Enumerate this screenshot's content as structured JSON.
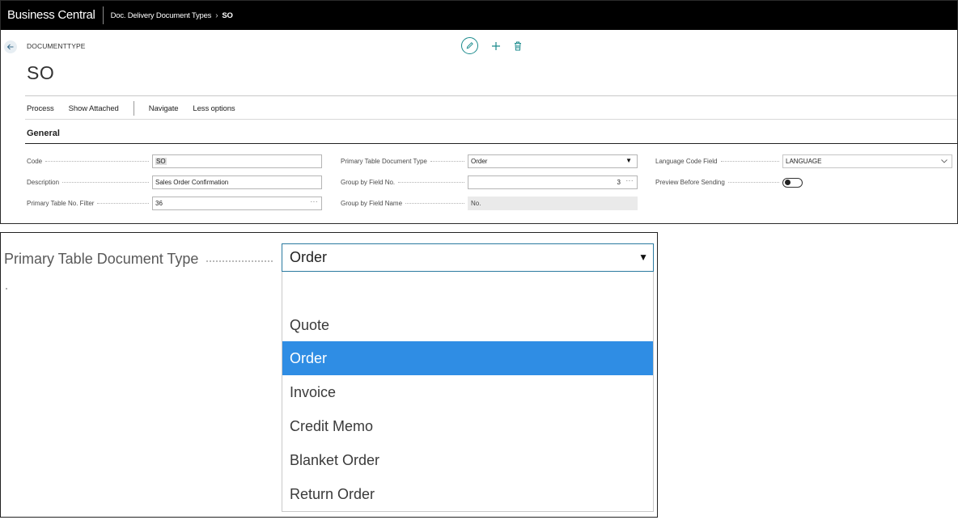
{
  "topbar": {
    "app_name": "Business Central",
    "breadcrumb_parent": "Doc. Delivery Document Types",
    "breadcrumb_separator": "›",
    "breadcrumb_current": "SO"
  },
  "page": {
    "caption": "DOCUMENTTYPE",
    "title": "SO"
  },
  "toolbar": {
    "edit_icon": "pencil-icon",
    "new_icon": "plus-icon",
    "delete_icon": "trash-icon"
  },
  "actions": {
    "process": "Process",
    "show_attached": "Show Attached",
    "navigate": "Navigate",
    "less_options": "Less options"
  },
  "section": {
    "title": "General"
  },
  "fields": {
    "code": {
      "label": "Code",
      "value": "SO"
    },
    "description": {
      "label": "Description",
      "value": "Sales Order Confirmation"
    },
    "primary_table_no_filter": {
      "label": "Primary Table No. Filter",
      "value": "36",
      "assist": "···"
    },
    "primary_table_document_type": {
      "label": "Primary Table Document Type",
      "value": "Order"
    },
    "group_by_field_no": {
      "label": "Group by Field No.",
      "value": "3",
      "assist": "···"
    },
    "group_by_field_name": {
      "label": "Group by Field Name",
      "value": "No."
    },
    "language_code_field": {
      "label": "Language Code Field",
      "value": "LANGUAGE"
    },
    "preview_before_sending": {
      "label": "Preview Before Sending",
      "value": false
    }
  },
  "dropdown": {
    "label": "Primary Table Document Type",
    "selected": "Order",
    "options": [
      {
        "label": "",
        "selected": false
      },
      {
        "label": "Quote",
        "selected": false
      },
      {
        "label": "Order",
        "selected": true
      },
      {
        "label": "Invoice",
        "selected": false
      },
      {
        "label": "Credit Memo",
        "selected": false
      },
      {
        "label": "Blanket Order",
        "selected": false
      },
      {
        "label": "Return Order",
        "selected": false
      }
    ]
  },
  "colors": {
    "topbar": "#000000",
    "accent_teal": "#1a8a8c",
    "selection_blue": "#2f8de4",
    "focus_border": "#2b7aa0"
  }
}
